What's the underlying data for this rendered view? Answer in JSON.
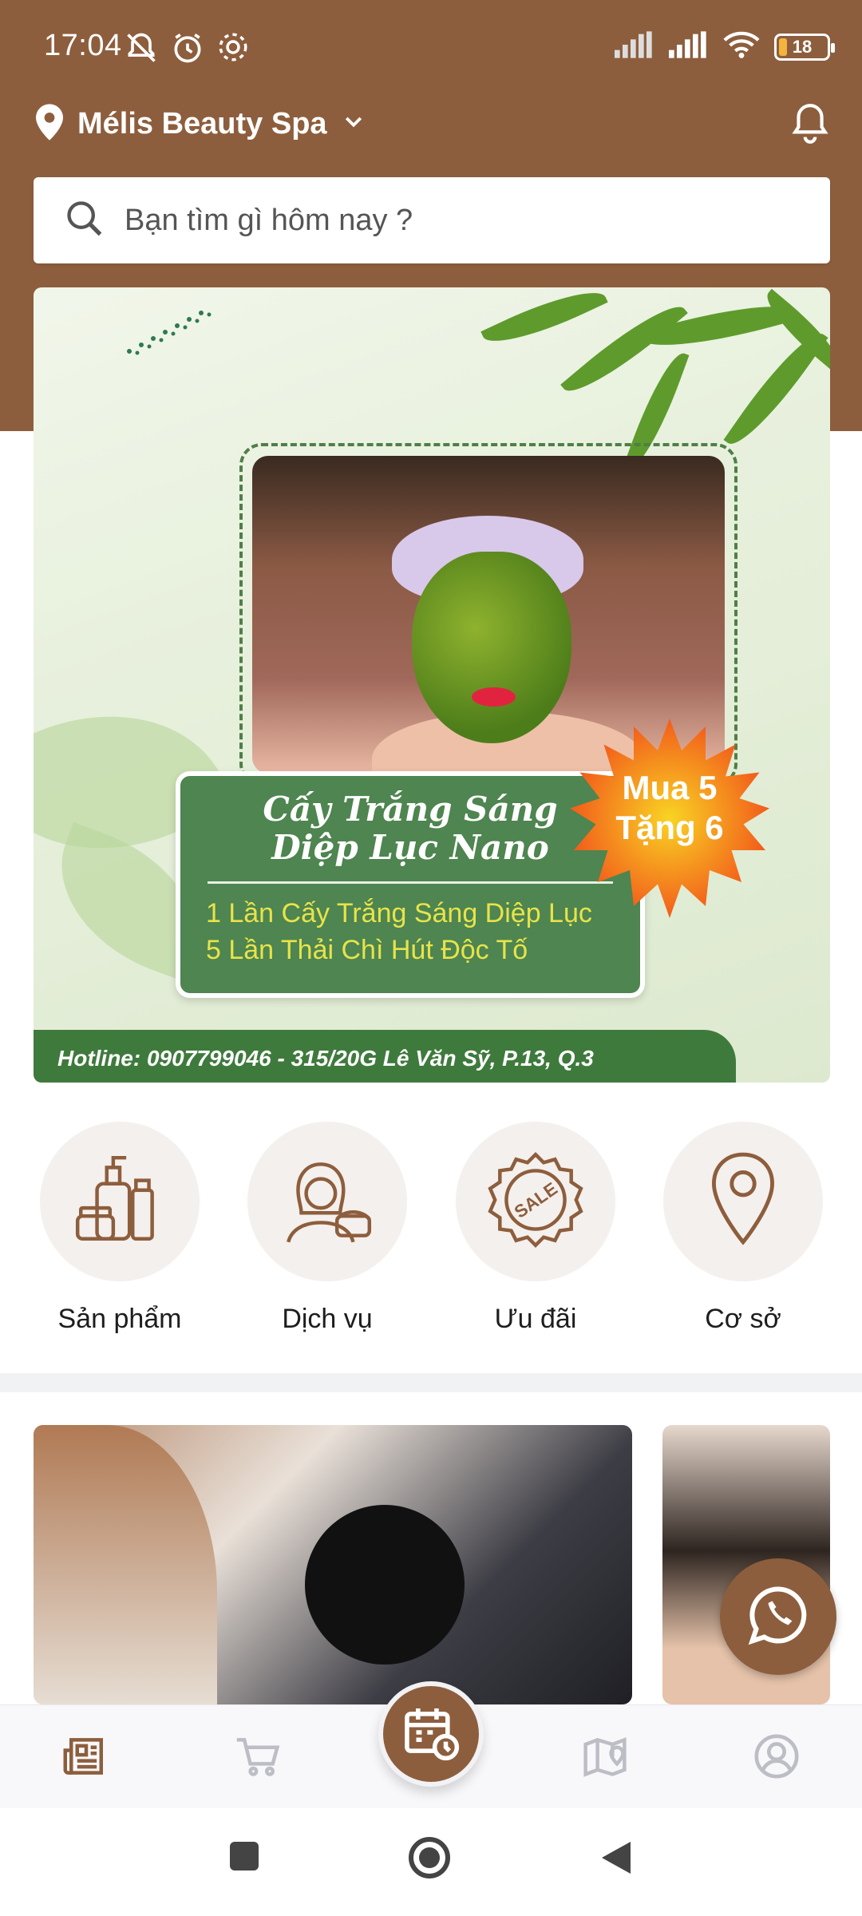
{
  "status_bar": {
    "time": "17:04",
    "battery": "18",
    "icons": [
      "mute-notification-icon",
      "alarm-icon",
      "gear-icon",
      "signal-icon",
      "signal-icon",
      "wifi-icon",
      "battery-icon"
    ]
  },
  "header": {
    "location_name": "Mélis Beauty Spa",
    "icons": [
      "location-pin-icon",
      "chevron-down-icon",
      "bell-icon"
    ]
  },
  "search": {
    "placeholder": "Bạn tìm gì hôm nay ?"
  },
  "banner": {
    "title_line1": "Cấy Trắng Sáng",
    "title_line2": "Diệp Lục Nano",
    "badge_line1": "Mua 5",
    "badge_line2": "Tặng 6",
    "detail_line1": "1 Lần Cấy Trắng Sáng Diệp Lục",
    "detail_line2": "5 Lần Thải Chì Hút Độc Tố",
    "hotline": "Hotline: 0907799046 - 315/20G Lê Văn Sỹ, P.13, Q.3"
  },
  "categories": [
    {
      "label": "Sản phẩm",
      "icon": "cosmetics-icon"
    },
    {
      "label": "Dịch vụ",
      "icon": "facial-service-icon"
    },
    {
      "label": "Ưu đãi",
      "icon": "sale-badge-icon"
    },
    {
      "label": "Cơ sở",
      "icon": "location-pin-icon"
    }
  ],
  "sale_badge_text": "SALE",
  "bottom_nav": {
    "items": [
      "news-icon",
      "cart-icon",
      "calendar-clock-icon",
      "map-icon",
      "user-icon"
    ]
  },
  "colors": {
    "brand_brown": "#8d5e3d",
    "banner_green": "#4e8550",
    "badge_orange": "#f47a20"
  }
}
